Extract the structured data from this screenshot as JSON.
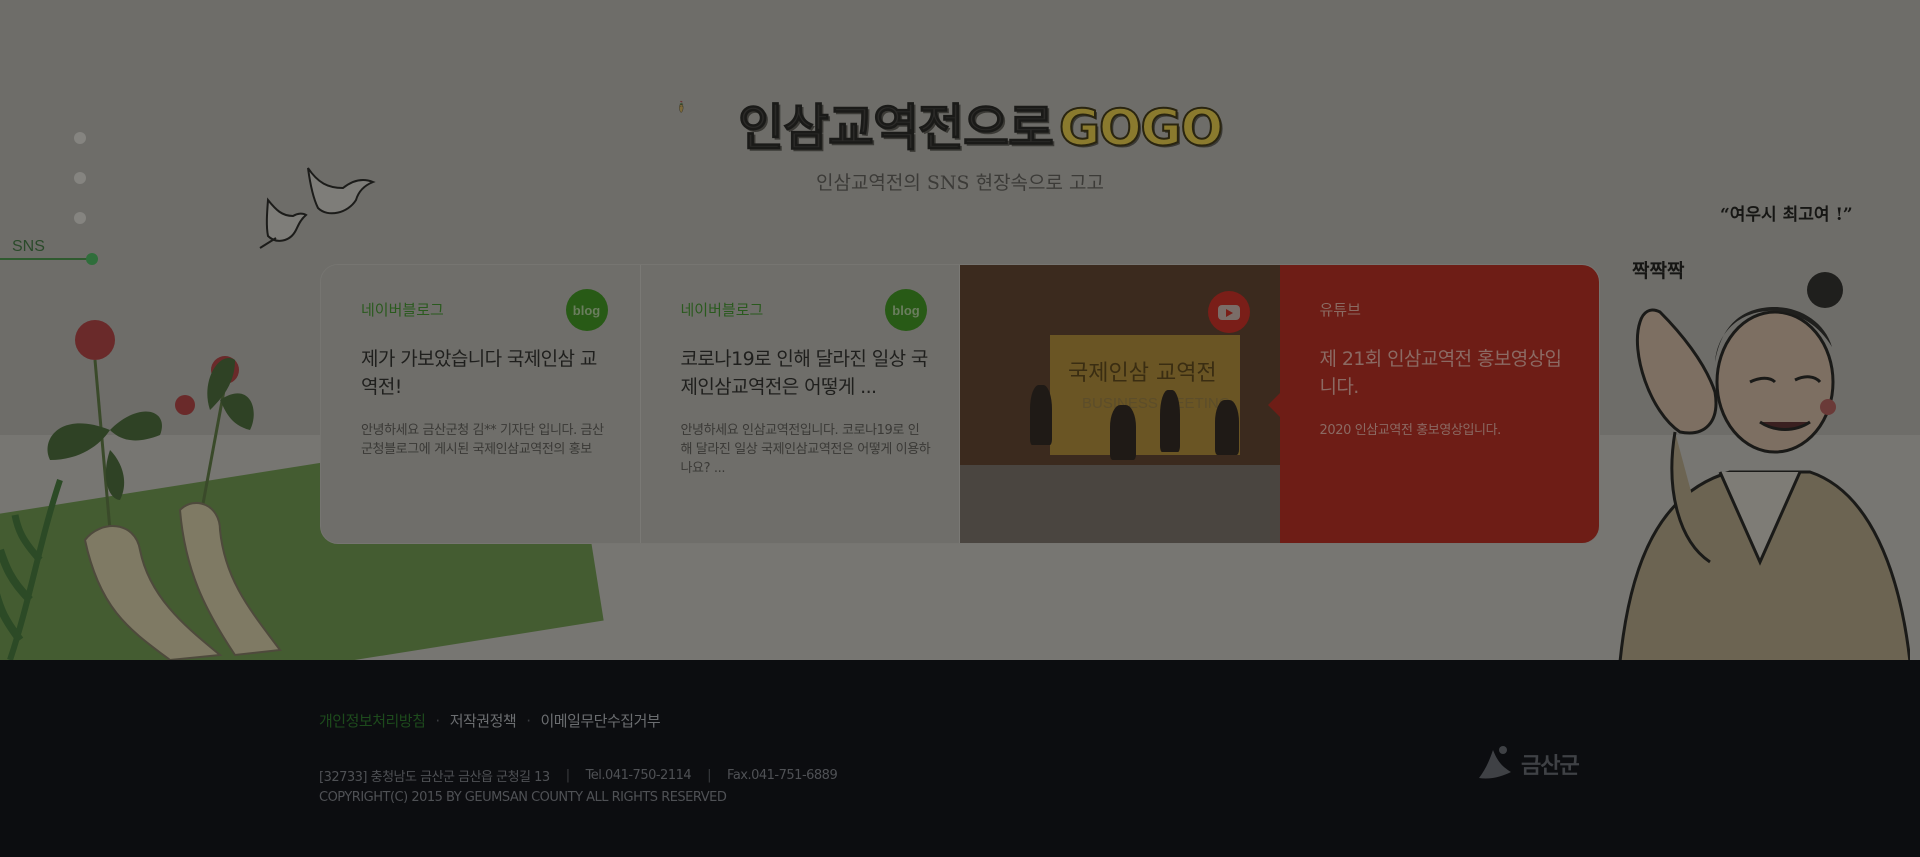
{
  "side_nav": {
    "label": "SNS"
  },
  "header": {
    "title_main": "인삼교역전으로",
    "title_accent": "GOGO",
    "subtitle": "인삼교역전의 SNS 현장속으로 고고"
  },
  "cards": [
    {
      "tag": "네이버블로그",
      "badge": "blog",
      "headline": "제가 가보았습니다 국제인삼 교역전!",
      "desc": "안녕하세요 금산군청 김** 기자단 입니다. 금산군청블로그에 게시된 국제인삼교역전의 홍보"
    },
    {
      "tag": "네이버블로그",
      "badge": "blog",
      "headline": "코로나19로 인해 달라진 일상 국제인삼교역전은 어떻게 ...",
      "desc": "안녕하세요 인삼교역전입니다. 코로나19로 인해 달라진 일상 국제인삼교역전은 어떻게 이용하나요? ..."
    },
    {
      "stage_text": "국제인삼 교역전",
      "stage_sub": "BUSINESS MEETING",
      "icon": "youtube-icon"
    },
    {
      "tag": "유튜브",
      "headline": "제 21회 인삼교역전 홍보영상입니다.",
      "desc": "2020 인삼교역전 홍보영상입니다."
    }
  ],
  "character": {
    "speech": "“여우시 최고여 !”",
    "clap": "짝짝짝"
  },
  "footer": {
    "links": [
      "개인정보처리방침",
      "저작권정책",
      "이메일무단수집거부"
    ],
    "address": "[32733] 충청남도 금산군 금산읍 군청길 13",
    "tel": "Tel.041-750-2114",
    "fax": "Fax.041-751-6889",
    "copyright": "COPYRIGHT(C) 2015 BY GEUMSAN COUNTY ALL RIGHTS RESERVED",
    "logo_name": "금산군"
  },
  "colors": {
    "overlay_bg": "#6e6d69",
    "accent_green": "#285a16",
    "video_card_red": "#6e1d16",
    "footer_bg": "#0c0d10"
  }
}
